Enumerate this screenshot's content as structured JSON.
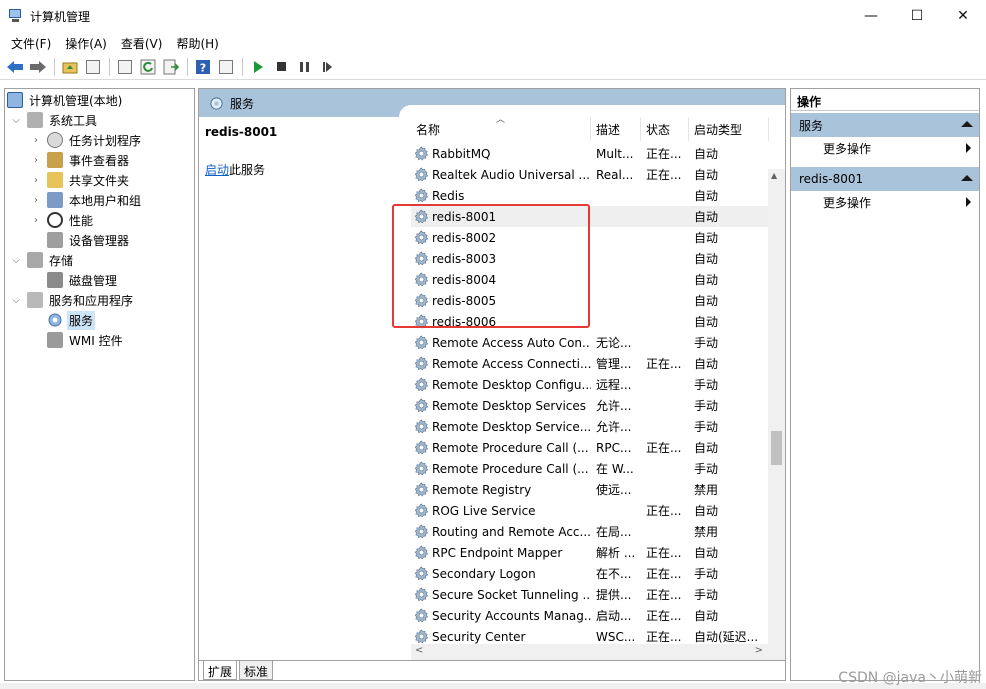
{
  "window": {
    "title": "计算机管理",
    "minimize": "—",
    "maximize": "☐",
    "close": "✕"
  },
  "menu": [
    "文件(F)",
    "操作(A)",
    "查看(V)",
    "帮助(H)"
  ],
  "tree": {
    "root": "计算机管理(本地)",
    "system_tools": "系统工具",
    "task_scheduler": "任务计划程序",
    "event_viewer": "事件查看器",
    "shared_folders": "共享文件夹",
    "local_users": "本地用户和组",
    "performance": "性能",
    "device_manager": "设备管理器",
    "storage": "存储",
    "disk_management": "磁盘管理",
    "services_apps": "服务和应用程序",
    "services": "服务",
    "wmi": "WMI 控件"
  },
  "middle": {
    "header": "服务",
    "selected_service": "redis-8001",
    "start_link": "启动",
    "start_suffix": "此服务"
  },
  "columns": {
    "name": "名称",
    "desc": "描述",
    "status": "状态",
    "start": "启动类型"
  },
  "services": [
    {
      "name": "RabbitMQ",
      "desc": "Mult...",
      "status": "正在...",
      "start": "自动"
    },
    {
      "name": "Realtek Audio Universal ...",
      "desc": "Real...",
      "status": "正在...",
      "start": "自动"
    },
    {
      "name": "Redis",
      "desc": "",
      "status": "",
      "start": "自动"
    },
    {
      "name": "redis-8001",
      "desc": "",
      "status": "",
      "start": "自动"
    },
    {
      "name": "redis-8002",
      "desc": "",
      "status": "",
      "start": "自动"
    },
    {
      "name": "redis-8003",
      "desc": "",
      "status": "",
      "start": "自动"
    },
    {
      "name": "redis-8004",
      "desc": "",
      "status": "",
      "start": "自动"
    },
    {
      "name": "redis-8005",
      "desc": "",
      "status": "",
      "start": "自动"
    },
    {
      "name": "redis-8006",
      "desc": "",
      "status": "",
      "start": "自动"
    },
    {
      "name": "Remote Access Auto Con...",
      "desc": "无论...",
      "status": "",
      "start": "手动"
    },
    {
      "name": "Remote Access Connecti...",
      "desc": "管理...",
      "status": "正在...",
      "start": "自动"
    },
    {
      "name": "Remote Desktop Configu...",
      "desc": "远程...",
      "status": "",
      "start": "手动"
    },
    {
      "name": "Remote Desktop Services",
      "desc": "允许...",
      "status": "",
      "start": "手动"
    },
    {
      "name": "Remote Desktop Service...",
      "desc": "允许...",
      "status": "",
      "start": "手动"
    },
    {
      "name": "Remote Procedure Call (...",
      "desc": "RPC...",
      "status": "正在...",
      "start": "自动"
    },
    {
      "name": "Remote Procedure Call (...",
      "desc": "在 W...",
      "status": "",
      "start": "手动"
    },
    {
      "name": "Remote Registry",
      "desc": "使远...",
      "status": "",
      "start": "禁用"
    },
    {
      "name": "ROG Live Service",
      "desc": "",
      "status": "正在...",
      "start": "自动"
    },
    {
      "name": "Routing and Remote Acc...",
      "desc": "在局...",
      "status": "",
      "start": "禁用"
    },
    {
      "name": "RPC Endpoint Mapper",
      "desc": "解析 ...",
      "status": "正在...",
      "start": "自动"
    },
    {
      "name": "Secondary Logon",
      "desc": "在不...",
      "status": "正在...",
      "start": "手动"
    },
    {
      "name": "Secure Socket Tunneling ...",
      "desc": "提供...",
      "status": "正在...",
      "start": "手动"
    },
    {
      "name": "Security Accounts Manag...",
      "desc": "启动...",
      "status": "正在...",
      "start": "自动"
    },
    {
      "name": "Security Center",
      "desc": "WSC...",
      "status": "正在...",
      "start": "自动(延迟..."
    }
  ],
  "tabs": {
    "extended": "扩展",
    "standard": "标准"
  },
  "actions": {
    "title": "操作",
    "group1": "服务",
    "group1_more": "更多操作",
    "group2": "redis-8001",
    "group2_more": "更多操作"
  },
  "watermark": "CSDN @java丶小萌新",
  "colors": {
    "header_blue": "#a9c3db",
    "highlight_red": "#e53935",
    "link": "#0b5fc5"
  }
}
